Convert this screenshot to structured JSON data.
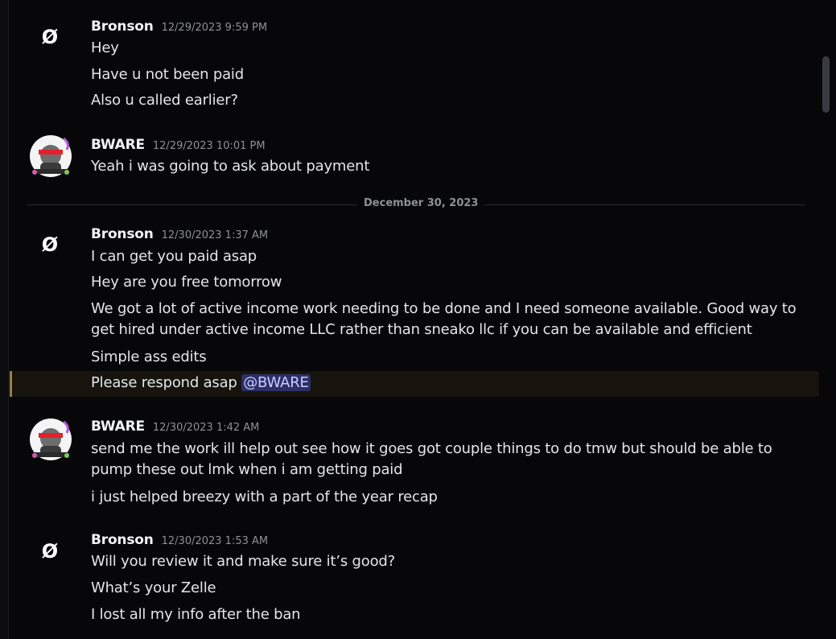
{
  "colors": {
    "background": "#070709",
    "mention_bg": "#2d3066",
    "highlight_border": "#9b7e42"
  },
  "top_fragment": "’",
  "date_divider": "December 30, 2023",
  "messages": [
    {
      "author": "Bronson",
      "timestamp": "12/29/2023 9:59 PM",
      "avatar_glyph": "Ø",
      "lines": [
        "Hey",
        "Have u not been paid",
        "Also u called earlier?"
      ]
    },
    {
      "author": "BWARE",
      "timestamp": "12/29/2023 10:01 PM",
      "avatar_icon": "bware-avatar-icon",
      "lines": [
        "Yeah i was going to ask about payment"
      ]
    },
    {
      "author": "Bronson",
      "timestamp": "12/30/2023 1:37 AM",
      "avatar_glyph": "Ø",
      "lines": [
        "I can get you paid asap",
        "Hey are you free tomorrow",
        "We got a lot of active income work needing to be done and I need someone available. Good way to get hired under active income LLC rather than sneako llc if you can be available and efficient",
        "Simple ass edits",
        "Please respond asap"
      ],
      "mention": "@BWARE"
    },
    {
      "author": "BWARE",
      "timestamp": "12/30/2023 1:42 AM",
      "avatar_icon": "bware-avatar-icon",
      "lines": [
        "send me the work ill help out see how it goes got couple things to do tmw but should be able to pump these out lmk when i am getting paid",
        "i just helped breezy with a part of the year recap"
      ]
    },
    {
      "author": "Bronson",
      "timestamp": "12/30/2023 1:53 AM",
      "avatar_glyph": "Ø",
      "lines": [
        "Will you review it and make sure it’s good?",
        "What’s your Zelle",
        "I lost all my info after the ban"
      ]
    }
  ]
}
